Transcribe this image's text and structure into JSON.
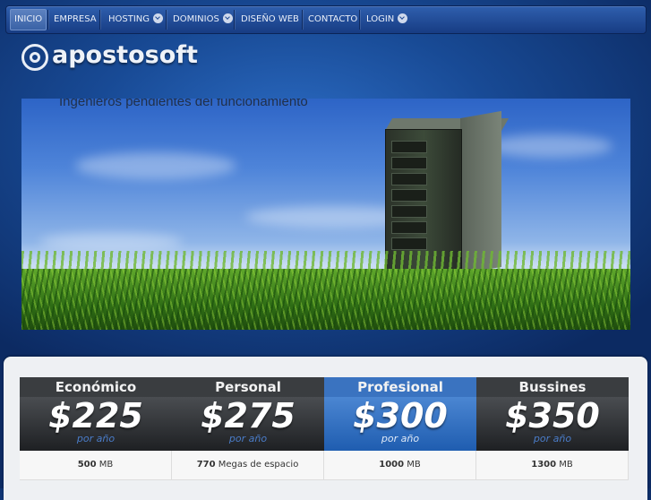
{
  "nav": {
    "items": [
      {
        "label": "INICIO",
        "active": true,
        "dropdown": false
      },
      {
        "label": "EMPRESA",
        "active": false,
        "dropdown": false
      },
      {
        "label": "HOSTING",
        "active": false,
        "dropdown": true
      },
      {
        "label": "DOMINIOS",
        "active": false,
        "dropdown": true
      },
      {
        "label": "DISEÑO WEB",
        "active": false,
        "dropdown": false
      },
      {
        "label": "CONTACTO",
        "active": false,
        "dropdown": false
      },
      {
        "label": "LOGIN",
        "active": false,
        "dropdown": true
      }
    ]
  },
  "logo": {
    "text": "apostosoft"
  },
  "banner": {
    "caption": "Ingenieros pendientes del funcionamiento"
  },
  "plans": [
    {
      "name": "Económico",
      "price": "$225",
      "period": "por año",
      "feature_value": "500",
      "feature_unit": "MB"
    },
    {
      "name": "Personal",
      "price": "$275",
      "period": "por año",
      "feature_value": "770",
      "feature_unit": "Megas de espacio"
    },
    {
      "name": "Profesional",
      "price": "$300",
      "period": "por año",
      "feature_value": "1000",
      "feature_unit": "MB",
      "featured": true
    },
    {
      "name": "Bussines",
      "price": "$350",
      "period": "por año",
      "feature_value": "1300",
      "feature_unit": "MB"
    }
  ],
  "colors": {
    "nav": "#1f4a95",
    "featured": "#3a73c0",
    "dark_header": "#3a3d40"
  }
}
